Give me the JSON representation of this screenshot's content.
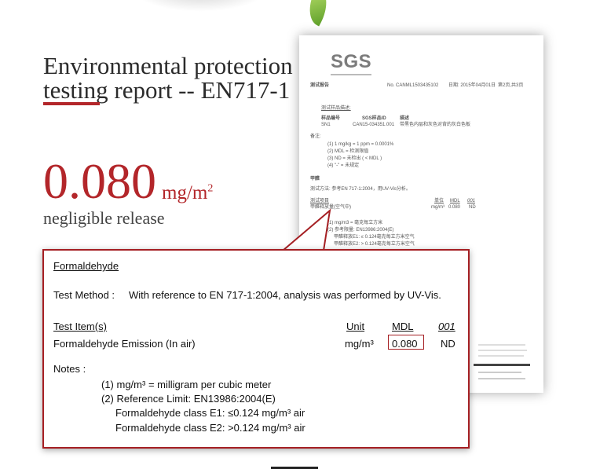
{
  "heading": {
    "line1": "Environmental protection",
    "line2": "testing report -- EN717-1"
  },
  "result": {
    "value": "0.080",
    "unit": "mg/m",
    "unit_sup": "2",
    "caption": "negligible release"
  },
  "report": {
    "logo": "SGS",
    "header_left": "测试报告",
    "header_no": "No. CANML1503435102",
    "header_date": "日期: 2015年04月01日",
    "header_page": "第2页,共3页",
    "section1": "测试样品描述:",
    "sample_headers": [
      "样品编号",
      "SGS样品ID",
      "描述"
    ],
    "sample_row": [
      "SN1",
      "CAN15-034351.001",
      "带黑色内层和灰色对背的灰白色板"
    ],
    "remarks_label": "备注:",
    "remarks": [
      "(1) 1 mg/kg = 1 ppm = 0.0001%",
      "(2) MDL = 检测限值",
      "(3) ND = 未检出 ( < MDL )",
      "(4) \"-\" = 未规定"
    ],
    "method_label": "甲醛",
    "method_text": "测试方法: 参考EN 717-1:2004，用UV-Vis分析。",
    "items_label": "测试项目",
    "items_cols": [
      "单位",
      "MDL",
      "001"
    ],
    "items_row": [
      "甲醛释放量(空气中)",
      "mg/m³",
      "0.080",
      "ND"
    ],
    "notes": [
      "(1) mg/m3 = 毫克每立方米",
      "(2) 参考限量: EN13986:2004(E)",
      "甲醛释放E1: ≤ 0.124毫克每立方米空气",
      "甲醛释放E2: > 0.124毫克每立方米空气"
    ]
  },
  "callout": {
    "title": "Formaldehyde",
    "method_label": "Test Method :",
    "method_text": "With reference to EN 717-1:2004, analysis was performed by UV-Vis.",
    "col_item": "Test Item(s)",
    "col_unit": "Unit",
    "col_mdl": "MDL",
    "col_sample": "001",
    "row_item": "Formaldehyde Emission (In air)",
    "row_unit": "mg/m³",
    "row_mdl": "0.080",
    "row_sample": "ND",
    "notes_label": "Notes :",
    "note1": "(1) mg/m³ = milligram per cubic meter",
    "note2": "(2) Reference Limit: EN13986:2004(E)",
    "note3": "Formaldehyde class E1: ≤0.124 mg/m³ air",
    "note4": "Formaldehyde class E2: >0.124 mg/m³ air"
  },
  "colors": {
    "accent": "#b3262a",
    "callout_border": "#a51f23"
  }
}
